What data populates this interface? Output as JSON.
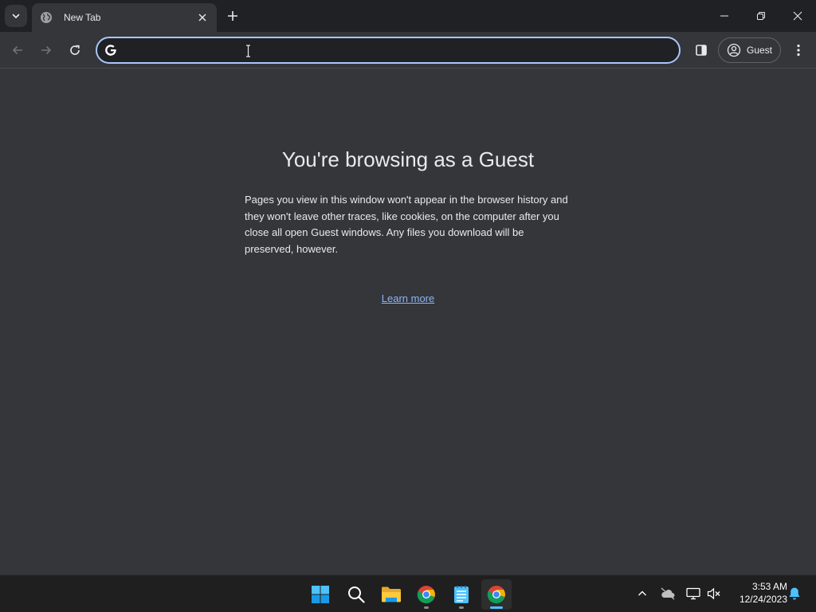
{
  "tabs": [
    {
      "title": "New Tab",
      "favicon": "globe-icon"
    }
  ],
  "omnibox": {
    "value": "",
    "placeholder": ""
  },
  "profile": {
    "label": "Guest"
  },
  "guest_page": {
    "title": "You're browsing as a Guest",
    "description": "Pages you view in this window won't appear in the browser history and they won't leave other traces, like cookies, on the computer after you close all open Guest windows. Any files you download will be preserved, however.",
    "learn_more": "Learn more"
  },
  "taskbar": {
    "apps": [
      "start-icon",
      "search-icon",
      "file-explorer-icon",
      "chrome-icon",
      "notepad-icon",
      "chrome-icon"
    ],
    "time": "3:53 AM",
    "date": "12/24/2023"
  },
  "colors": {
    "background": "#35363a",
    "tabstrip": "#202124",
    "accent": "#a8c7fa",
    "link": "#8ab4f8"
  }
}
